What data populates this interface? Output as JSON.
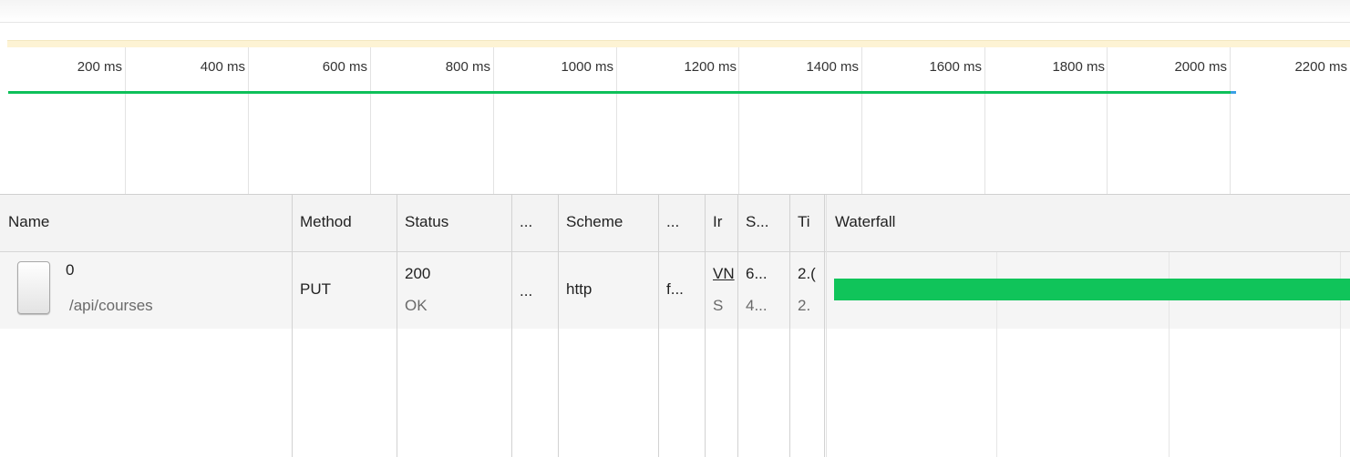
{
  "overview": {
    "ticks": [
      "200 ms",
      "400 ms",
      "600 ms",
      "800 ms",
      "1000 ms",
      "1200 ms",
      "1400 ms",
      "1600 ms",
      "1800 ms",
      "2000 ms",
      "2200 ms"
    ]
  },
  "columns": {
    "name": "Name",
    "method": "Method",
    "status": "Status",
    "col_ellipsis_1": "...",
    "scheme": "Scheme",
    "col_ellipsis_2": "...",
    "initiator": "Ir",
    "size": "S...",
    "time": "Ti",
    "waterfall": "Waterfall"
  },
  "request": {
    "name": "0",
    "path": "/api/courses",
    "method": "PUT",
    "status_code": "200",
    "status_text": "OK",
    "col_ellipsis_1": "...",
    "scheme": "http",
    "col_ellipsis_2": "f...",
    "initiator": "VN",
    "initiator_sub": "S",
    "size": "6...",
    "size_sub": "4...",
    "time": "2.(",
    "time_sub": "2."
  },
  "colors": {
    "timeline_bar": "#0ec05a",
    "waterfall_bar": "#10c45a"
  },
  "waterfall": {
    "request_progress": 1.0
  }
}
